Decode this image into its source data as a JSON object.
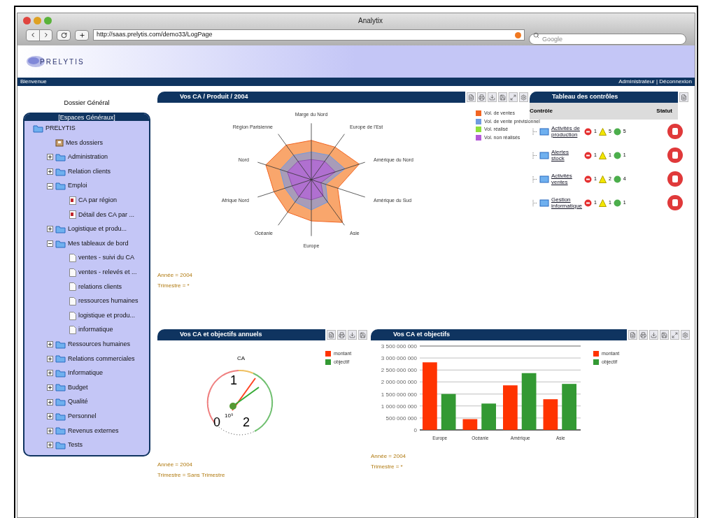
{
  "window": {
    "title": "Analytix"
  },
  "toolbar": {
    "url": "http://saas.prelytis.com/demo33/LogPage",
    "search_placeholder": "Google"
  },
  "header": {
    "logo": "PRELYTIS",
    "welcome": "Bienvenue",
    "user_links": "Administrateur | Déconnexion"
  },
  "sidebar": {
    "title": "Dossier Général",
    "panel_title": "[Espaces Généraux]",
    "tree": [
      {
        "label": "PRELYTIS",
        "kind": "root",
        "children": [
          {
            "label": "Mes dossiers",
            "kind": "home"
          },
          {
            "label": "Administration",
            "kind": "folder",
            "expanded": false
          },
          {
            "label": "Relation clients",
            "kind": "folder",
            "expanded": false
          },
          {
            "label": "Emploi",
            "kind": "folder",
            "expanded": true,
            "children": [
              {
                "label": "CA par région",
                "kind": "report"
              },
              {
                "label": "Détail des CA par ...",
                "kind": "report"
              }
            ]
          },
          {
            "label": "Logistique et produ...",
            "kind": "folder",
            "expanded": false
          },
          {
            "label": "Mes tableaux de bord",
            "kind": "folder",
            "expanded": true,
            "children": [
              {
                "label": "ventes - suivi du CA",
                "kind": "doc"
              },
              {
                "label": "ventes - relevés et ...",
                "kind": "doc"
              },
              {
                "label": "relations clients",
                "kind": "doc"
              },
              {
                "label": "ressources humaines",
                "kind": "doc"
              },
              {
                "label": "logistique et produ...",
                "kind": "doc"
              },
              {
                "label": "informatique",
                "kind": "doc"
              }
            ]
          },
          {
            "label": "Ressources humaines",
            "kind": "folder",
            "expanded": false
          },
          {
            "label": "Relations commerciales",
            "kind": "folder",
            "expanded": false
          },
          {
            "label": "Informatique",
            "kind": "folder",
            "expanded": false
          },
          {
            "label": "Budget",
            "kind": "folder",
            "expanded": false
          },
          {
            "label": "Qualité",
            "kind": "folder",
            "expanded": false
          },
          {
            "label": "Personnel",
            "kind": "folder",
            "expanded": false
          },
          {
            "label": "Revenus externes",
            "kind": "folder",
            "expanded": false
          },
          {
            "label": "Tests",
            "kind": "folder",
            "expanded": false
          }
        ]
      }
    ]
  },
  "radar_panel": {
    "title": "Vos CA / Produit / 2004",
    "axes": [
      "Marge du Nord",
      "Région Parisienne",
      "Europe de l'Est",
      "Nord",
      "Amérique du Nord",
      "Afrique Nord",
      "Amérique du Sud",
      "Océanie",
      "Asie",
      "Europe"
    ],
    "legend": [
      {
        "label": "Vol. de ventes",
        "color": "#f26522"
      },
      {
        "label": "Vol. de vente prévisionnel",
        "color": "#6f9be0"
      },
      {
        "label": "Vol. réalisé",
        "color": "#8ee03a"
      },
      {
        "label": "Vol. non réalisés",
        "color": "#b45ad8"
      }
    ],
    "filters": [
      "Année = 2004",
      "Trimestre = *"
    ]
  },
  "control_panel": {
    "title": "Tableau des contrôles",
    "columns": [
      "Contrôle",
      "Statut"
    ],
    "rows": [
      {
        "name": "Activités de production",
        "errors": "1",
        "warnings": "5",
        "ok": "5"
      },
      {
        "name": "Alertes stock",
        "errors": "1",
        "warnings": "1",
        "ok": "1"
      },
      {
        "name": "Activités ventes",
        "errors": "1",
        "warnings": "2",
        "ok": "4"
      },
      {
        "name": "Gestion informatique",
        "errors": "1",
        "warnings": "1",
        "ok": "1"
      }
    ]
  },
  "gauge_panel": {
    "title": "Vos CA et objectifs annuels",
    "gauge_label": "CA",
    "scale": [
      "0",
      "1",
      "2"
    ],
    "unit": "10⁹",
    "legend": [
      {
        "label": "montant",
        "color": "#ff3300"
      },
      {
        "label": "objectif",
        "color": "#339933"
      }
    ],
    "filters": [
      "Année = 2004",
      "Trimestre = Sans Trimestre"
    ]
  },
  "bar_panel": {
    "title": "Vos CA et objectifs",
    "chart_data": {
      "type": "bar",
      "categories": [
        "Europe",
        "Océanie",
        "Amérique",
        "Asie"
      ],
      "series": [
        {
          "name": "montant",
          "color": "#ff3300",
          "values": [
            2820000000,
            450000000,
            1860000000,
            1280000000
          ]
        },
        {
          "name": "objectif",
          "color": "#339933",
          "values": [
            1500000000,
            1100000000,
            2370000000,
            1920000000
          ]
        }
      ],
      "ylim": [
        0,
        3500000000
      ],
      "grid": true,
      "yticks": [
        {
          "value": 0,
          "label": "0"
        },
        {
          "value": 500000000,
          "label": "500 000 000"
        },
        {
          "value": 1000000000,
          "label": "1 000 000 000"
        },
        {
          "value": 1500000000,
          "label": "1 500 000 000"
        },
        {
          "value": 2000000000,
          "label": "2 000 000 000"
        },
        {
          "value": 2500000000,
          "label": "2 500 000 000"
        },
        {
          "value": 3000000000,
          "label": "3 000 000 000"
        },
        {
          "value": 3500000000,
          "label": "3 500 000 000"
        }
      ]
    },
    "filters": [
      "Année = 2004",
      "Trimestre = *"
    ]
  }
}
